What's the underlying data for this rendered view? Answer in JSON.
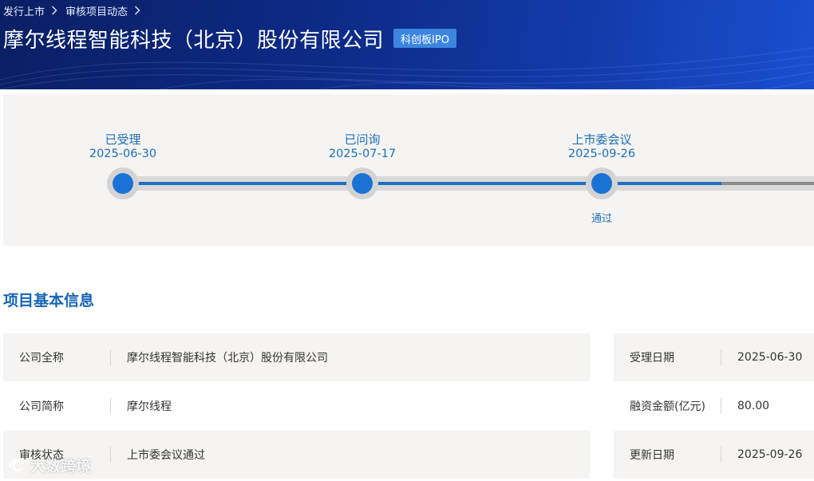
{
  "breadcrumb": {
    "items": [
      "发行上市",
      "审核项目动态"
    ]
  },
  "header": {
    "company_name": "摩尔线程智能科技（北京）股份有限公司",
    "board_badge": "科创板IPO"
  },
  "progress": {
    "steps": [
      {
        "label": "已受理",
        "date": "2025-06-30",
        "result": ""
      },
      {
        "label": "已问询",
        "date": "2025-07-17",
        "result": ""
      },
      {
        "label": "上市委会议",
        "date": "2025-09-26",
        "result": "通过"
      }
    ],
    "active_color": "#1a73d4"
  },
  "section": {
    "title": "项目基本信息"
  },
  "info_left": [
    {
      "label": "公司全称",
      "value": "摩尔线程智能科技（北京）股份有限公司"
    },
    {
      "label": "公司简称",
      "value": "摩尔线程"
    },
    {
      "label": "审核状态",
      "value": "上市委会议通过"
    }
  ],
  "info_right": [
    {
      "label": "受理日期",
      "value": "2025-06-30"
    },
    {
      "label": "融资金额(亿元)",
      "value": "80.00"
    },
    {
      "label": "更新日期",
      "value": "2025-09-26"
    }
  ],
  "watermark": {
    "text": "大数跨境"
  },
  "colors": {
    "banner": "#0d2a86",
    "accent": "#1565b5",
    "badge": "#3d86e0"
  }
}
